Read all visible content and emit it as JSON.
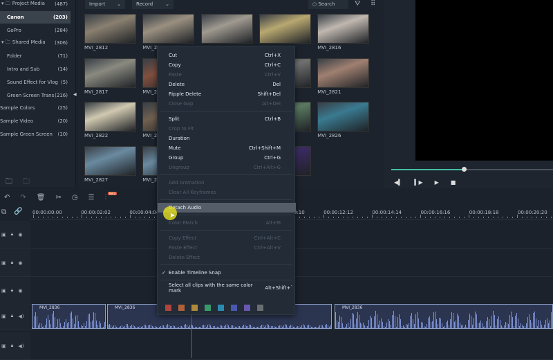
{
  "sidebar": {
    "items": [
      {
        "label": "Project Media",
        "count": "(487)",
        "folder": true
      },
      {
        "label": "Canon",
        "count": "(203)",
        "selected": true
      },
      {
        "label": "GoPro",
        "count": "(284)"
      },
      {
        "label": "Shared Media",
        "count": "(306)",
        "folder": true
      },
      {
        "label": "Folder",
        "count": "(71)"
      },
      {
        "label": "Intro and Sub",
        "count": "(14)"
      },
      {
        "label": "Sound Effect for Vlog",
        "count": "(5)"
      },
      {
        "label": "Green Screen Trans",
        "count": "(216)"
      },
      {
        "label": "Sample Colors",
        "count": "(25)"
      },
      {
        "label": "Sample Video",
        "count": "(20)"
      },
      {
        "label": "Sample Green Screen",
        "count": "(10)"
      }
    ]
  },
  "media": {
    "import_label": "Import",
    "record_label": "Record",
    "search_placeholder": "Search",
    "thumbs": [
      {
        "label": "MVI_2812",
        "color": "#8a8070"
      },
      {
        "label": "MVI_2813",
        "color": "#9a9080"
      },
      {
        "label": "MVI_2814",
        "color": "#a09a90"
      },
      {
        "label": "MVI_2815",
        "color": "#b8a870"
      },
      {
        "label": "MVI_2816",
        "color": "#c0b8b0"
      },
      {
        "label": "MVI_2817",
        "color": "#8a8a80"
      },
      {
        "label": "MVI_2818",
        "color": "#805040"
      },
      {
        "label": "MVI_2819",
        "color": "#707070"
      },
      {
        "label": "MVI_2820",
        "color": "#707070"
      },
      {
        "label": "MVI_2821",
        "color": "#a08070"
      },
      {
        "label": "MVI_2822",
        "color": "#d0c8b0"
      },
      {
        "label": "MVI_2823",
        "color": "#706050"
      },
      {
        "label": "MVI_2824",
        "color": "#607080"
      },
      {
        "label": "MVI_2825",
        "color": "#5a7a60"
      },
      {
        "label": "MVI_2826",
        "color": "#3a7a90"
      },
      {
        "label": "MVI_2827",
        "color": "#6a8aa0"
      },
      {
        "label": "MVI_2828",
        "color": "#6a8aa0"
      },
      {
        "label": "MVI_2829",
        "color": "#607080"
      },
      {
        "label": "rter 1...",
        "color": "#3a2a60"
      }
    ]
  },
  "preview": {
    "progress": 0.45,
    "accent": "#3fc1a5"
  },
  "timeline": {
    "ruler": [
      "00:00:00:00",
      "00:00:02:02",
      "00:00:04:04",
      "00:00:06:06",
      "00:00:08:08",
      "00:00:10:10",
      "00:00:12:12",
      "00:00:14:14",
      "00:00:16:16",
      "00:00:18:18",
      "00:00:20:20"
    ],
    "clips": [
      {
        "label": "MVI_2836"
      },
      {
        "label": "MVI_2836"
      },
      {
        "label": "MVI_2836"
      }
    ],
    "beta_badge": "Beta"
  },
  "menu": {
    "items": [
      {
        "label": "Cut",
        "shortcut": "Ctrl+X"
      },
      {
        "label": "Copy",
        "shortcut": "Ctrl+C"
      },
      {
        "label": "Paste",
        "shortcut": "Ctrl+V",
        "disabled": true
      },
      {
        "label": "Delete",
        "shortcut": "Del"
      },
      {
        "label": "Ripple Delete",
        "shortcut": "Shift+Del"
      },
      {
        "label": "Close Gap",
        "shortcut": "Alt+Del",
        "disabled": true
      },
      {
        "sep": true
      },
      {
        "label": "Split",
        "shortcut": "Ctrl+B"
      },
      {
        "label": "Crop to Fit",
        "shortcut": "",
        "disabled": true
      },
      {
        "label": "Duration",
        "shortcut": ""
      },
      {
        "label": "Mute",
        "shortcut": "Ctrl+Shift+M"
      },
      {
        "label": "Group",
        "shortcut": "Ctrl+G"
      },
      {
        "label": "Ungroup",
        "shortcut": "Ctrl+Alt+G",
        "disabled": true
      },
      {
        "sep": true
      },
      {
        "label": "Add Animation",
        "shortcut": "",
        "disabled": true
      },
      {
        "label": "Clear All Keyframes",
        "shortcut": "",
        "disabled": true
      },
      {
        "sep": true
      },
      {
        "label": "Detach Audio",
        "shortcut": "",
        "highlighted": true
      },
      {
        "sep": true
      },
      {
        "label": "Color Match",
        "shortcut": "Alt+M",
        "disabled": true
      },
      {
        "sep": true
      },
      {
        "label": "Copy Effect",
        "shortcut": "Ctrl+Alt+C",
        "disabled": true
      },
      {
        "label": "Paste Effect",
        "shortcut": "Ctrl+Alt+V",
        "disabled": true
      },
      {
        "label": "Delete Effect",
        "shortcut": "",
        "disabled": true
      },
      {
        "sep": true
      },
      {
        "label": "Enable Timeline Snap",
        "shortcut": "",
        "checked": true
      },
      {
        "sep": true
      },
      {
        "label": "Select all clips with the same color mark",
        "shortcut": "Alt+Shift+`"
      }
    ],
    "color_marks": [
      "#b0443e",
      "#b0603a",
      "#b08a3a",
      "#3a9a6a",
      "#2a8ab0",
      "#4a58b0",
      "#6a58b0",
      "#6a6e72"
    ]
  }
}
